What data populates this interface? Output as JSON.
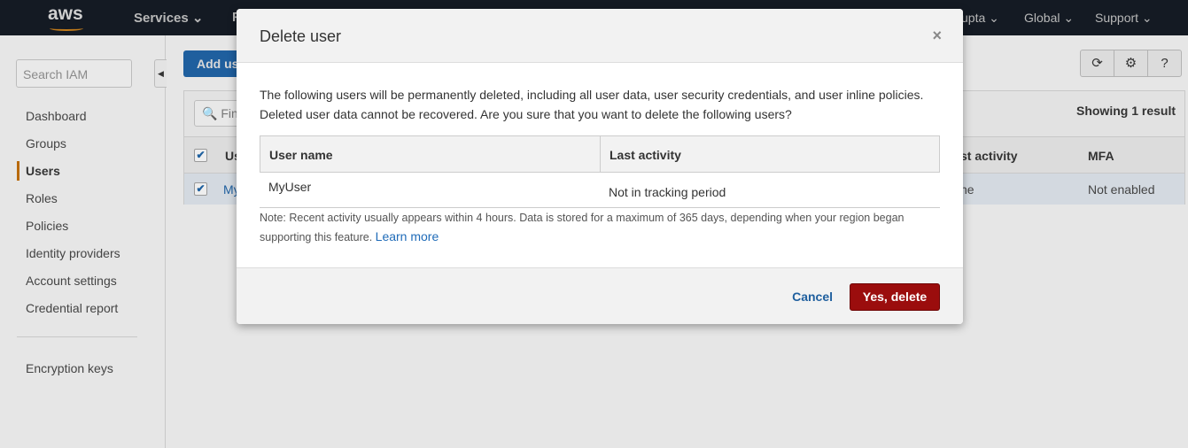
{
  "nav": {
    "logo": "aws",
    "services": "Services",
    "user": "upta",
    "region": "Global",
    "support": "Support",
    "user_partial": "R"
  },
  "sidebar": {
    "search_placeholder": "Search IAM",
    "items": [
      {
        "label": "Dashboard"
      },
      {
        "label": "Groups"
      },
      {
        "label": "Users",
        "active": true
      },
      {
        "label": "Roles"
      },
      {
        "label": "Policies"
      },
      {
        "label": "Identity providers"
      },
      {
        "label": "Account settings"
      },
      {
        "label": "Credential report"
      },
      {
        "label": "Encryption keys"
      }
    ]
  },
  "main": {
    "add_user": "Add us",
    "find": "Find",
    "showing": "Showing 1 result",
    "columns": {
      "user": "Us",
      "last_activity": "st activity",
      "mfa": "MFA"
    },
    "row": {
      "user": "My",
      "last_activity": "ne",
      "mfa": "Not enabled"
    }
  },
  "modal": {
    "title": "Delete user",
    "close": "×",
    "message": "The following users will be permanently deleted, including all user data, user security credentials, and user inline policies. Deleted user data cannot be recovered. Are you sure that you want to delete the following users?",
    "columns": [
      "User name",
      "Last activity"
    ],
    "rows": [
      {
        "user": "MyUser",
        "last_activity": "Not in tracking period"
      }
    ],
    "note": "Note: Recent activity usually appears within 4 hours. Data is stored for a maximum of 365 days, depending when your region began supporting this feature.",
    "learn_more": "Learn more",
    "cancel": "Cancel",
    "confirm": "Yes, delete"
  },
  "colors": {
    "nav": "#232f3e",
    "accent": "#ec7211",
    "danger": "#9b0d0d",
    "link": "#1f6bb8"
  }
}
